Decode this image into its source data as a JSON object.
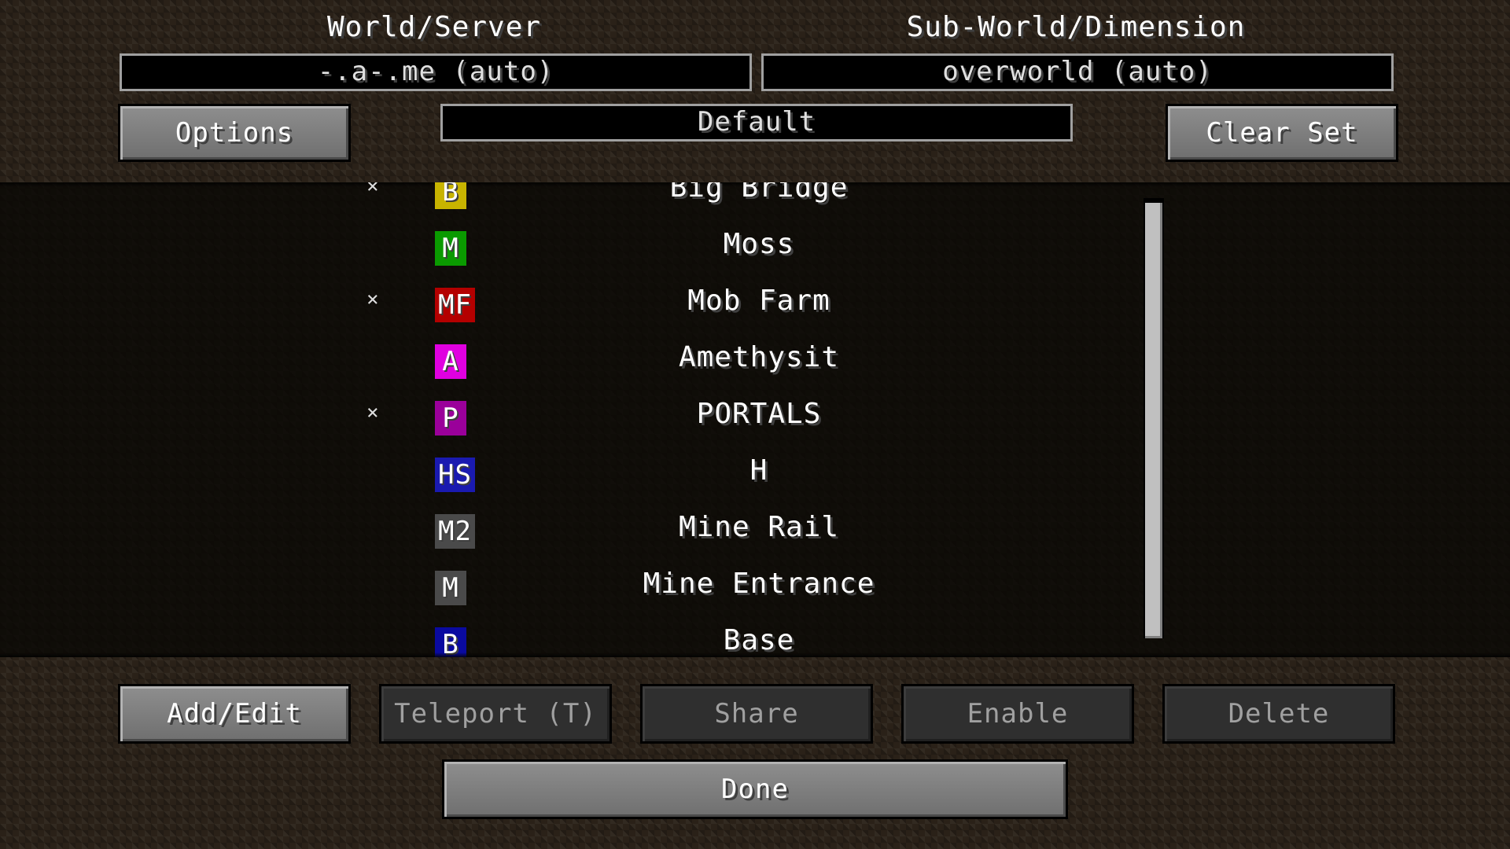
{
  "header": {
    "world_label": "World/Server",
    "subworld_label": "Sub-World/Dimension",
    "world_value": "-.a-.me (auto)",
    "subworld_value": "overworld (auto)",
    "set_value": "Default",
    "options_label": "Options",
    "clear_set_label": "Clear Set"
  },
  "waypoints": [
    {
      "icon": "B",
      "name": "Big Bridge",
      "starred": true,
      "color": "#c8b400"
    },
    {
      "icon": "M",
      "name": "Moss",
      "starred": false,
      "color": "#0a9a00"
    },
    {
      "icon": "MF",
      "name": "Mob Farm",
      "starred": true,
      "color": "#b40000"
    },
    {
      "icon": "A",
      "name": "Amethysit",
      "starred": false,
      "color": "#e000e0"
    },
    {
      "icon": "P",
      "name": "PORTALS",
      "starred": true,
      "color": "#9a009a"
    },
    {
      "icon": "HS",
      "name": "H",
      "starred": false,
      "color": "#1a1ab0"
    },
    {
      "icon": "M2",
      "name": "Mine Rail",
      "starred": false,
      "color": "#4a4a4a"
    },
    {
      "icon": "M",
      "name": "Mine Entrance",
      "starred": false,
      "color": "#4a4a4a"
    },
    {
      "icon": "B",
      "name": "Base",
      "starred": false,
      "color": "#0a0aa0"
    }
  ],
  "star_symbol": "×",
  "footer": {
    "add_edit_label": "Add/Edit",
    "teleport_label": "Teleport (T)",
    "share_label": "Share",
    "enable_label": "Enable",
    "delete_label": "Delete",
    "done_label": "Done"
  }
}
